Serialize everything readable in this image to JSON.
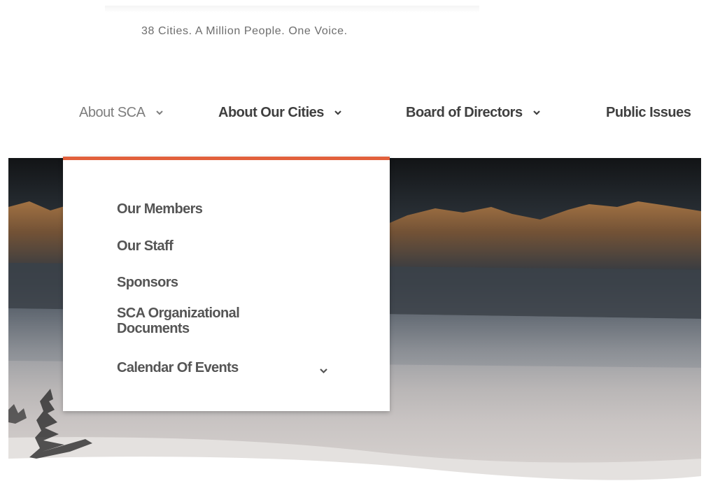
{
  "site": {
    "tagline": "38 Cities. A Million People. One Voice."
  },
  "nav": {
    "items": [
      {
        "label": "About SCA",
        "active": true,
        "icon": "chevron-down-icon"
      },
      {
        "label": "About Our Cities",
        "active": false,
        "icon": "chevron-down-icon"
      },
      {
        "label": "Board of Directors",
        "active": false,
        "icon": "chevron-down-icon"
      },
      {
        "label": "Public Issues",
        "active": false
      }
    ]
  },
  "dropdown": {
    "accent_color": "#e2603c",
    "items": [
      {
        "label": "Our Members"
      },
      {
        "label": "Our Staff"
      },
      {
        "label": "Sponsors"
      },
      {
        "label": "SCA Organizational Documents"
      },
      {
        "label": "Calendar Of Events",
        "icon": "chevron-down-icon"
      }
    ]
  }
}
